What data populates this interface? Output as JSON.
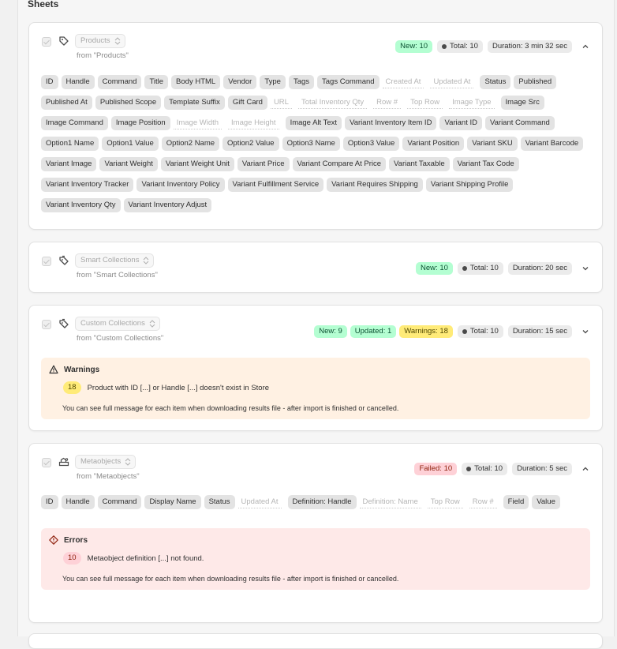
{
  "header": {
    "title": "Sheets"
  },
  "sheets": [
    {
      "name": "Products",
      "from": "from \"Products\"",
      "badges": {
        "new": "New: 10",
        "total": "Total: 10",
        "duration": "Duration: 3 min 32 sec"
      },
      "expanded": true,
      "fields": [
        {
          "label": "ID",
          "active": true
        },
        {
          "label": "Handle",
          "active": true
        },
        {
          "label": "Command",
          "active": true
        },
        {
          "label": "Title",
          "active": true
        },
        {
          "label": "Body HTML",
          "active": true
        },
        {
          "label": "Vendor",
          "active": true
        },
        {
          "label": "Type",
          "active": true
        },
        {
          "label": "Tags",
          "active": true
        },
        {
          "label": "Tags Command",
          "active": true
        },
        {
          "label": "Created At",
          "active": false
        },
        {
          "label": "Updated At",
          "active": false
        },
        {
          "label": "Status",
          "active": true
        },
        {
          "label": "Published",
          "active": true
        },
        {
          "label": "Published At",
          "active": true
        },
        {
          "label": "Published Scope",
          "active": true
        },
        {
          "label": "Template Suffix",
          "active": true
        },
        {
          "label": "Gift Card",
          "active": true
        },
        {
          "label": "URL",
          "active": false
        },
        {
          "label": "Total Inventory Qty",
          "active": false
        },
        {
          "label": "Row #",
          "active": false
        },
        {
          "label": "Top Row",
          "active": false
        },
        {
          "label": "Image Type",
          "active": false
        },
        {
          "label": "Image Src",
          "active": true
        },
        {
          "label": "Image Command",
          "active": true
        },
        {
          "label": "Image Position",
          "active": true
        },
        {
          "label": "Image Width",
          "active": false
        },
        {
          "label": "Image Height",
          "active": false
        },
        {
          "label": "Image Alt Text",
          "active": true
        },
        {
          "label": "Variant Inventory Item ID",
          "active": true
        },
        {
          "label": "Variant ID",
          "active": true
        },
        {
          "label": "Variant Command",
          "active": true
        },
        {
          "label": "Option1 Name",
          "active": true
        },
        {
          "label": "Option1 Value",
          "active": true
        },
        {
          "label": "Option2 Name",
          "active": true
        },
        {
          "label": "Option2 Value",
          "active": true
        },
        {
          "label": "Option3 Name",
          "active": true
        },
        {
          "label": "Option3 Value",
          "active": true
        },
        {
          "label": "Variant Position",
          "active": true
        },
        {
          "label": "Variant SKU",
          "active": true
        },
        {
          "label": "Variant Barcode",
          "active": true
        },
        {
          "label": "Variant Image",
          "active": true
        },
        {
          "label": "Variant Weight",
          "active": true
        },
        {
          "label": "Variant Weight Unit",
          "active": true
        },
        {
          "label": "Variant Price",
          "active": true
        },
        {
          "label": "Variant Compare At Price",
          "active": true
        },
        {
          "label": "Variant Taxable",
          "active": true
        },
        {
          "label": "Variant Tax Code",
          "active": true
        },
        {
          "label": "Variant Inventory Tracker",
          "active": true
        },
        {
          "label": "Variant Inventory Policy",
          "active": true
        },
        {
          "label": "Variant Fulfillment Service",
          "active": true
        },
        {
          "label": "Variant Requires Shipping",
          "active": true
        },
        {
          "label": "Variant Shipping Profile",
          "active": true
        },
        {
          "label": "Variant Inventory Qty",
          "active": true
        },
        {
          "label": "Variant Inventory Adjust",
          "active": true
        }
      ]
    },
    {
      "name": "Smart Collections",
      "from": "from \"Smart Collections\"",
      "badges": {
        "new": "New: 10",
        "total": "Total: 10",
        "duration": "Duration: 20 sec"
      },
      "expanded": false
    },
    {
      "name": "Custom Collections",
      "from": "from \"Custom Collections\"",
      "badges": {
        "new": "New: 9",
        "updated": "Updated: 1",
        "warnings": "Warnings: 18",
        "total": "Total: 10",
        "duration": "Duration: 15 sec"
      },
      "expanded": false,
      "banner": {
        "title": "Warnings",
        "count": "18",
        "message": "Product with ID [...] or Handle [...] doesn't exist in Store",
        "note": "You can see full message for each item when downloading results file - after import is finished or cancelled."
      }
    },
    {
      "name": "Metaobjects",
      "from": "from \"Metaobjects\"",
      "badges": {
        "failed": "Failed: 10",
        "total": "Total: 10",
        "duration": "Duration: 5 sec"
      },
      "expanded": true,
      "fields": [
        {
          "label": "ID",
          "active": true
        },
        {
          "label": "Handle",
          "active": true
        },
        {
          "label": "Command",
          "active": true
        },
        {
          "label": "Display Name",
          "active": true
        },
        {
          "label": "Status",
          "active": true
        },
        {
          "label": "Updated At",
          "active": false
        },
        {
          "label": "Definition: Handle",
          "active": true
        },
        {
          "label": "Definition: Name",
          "active": false
        },
        {
          "label": "Top Row",
          "active": false
        },
        {
          "label": "Row #",
          "active": false
        },
        {
          "label": "Field",
          "active": true
        },
        {
          "label": "Value",
          "active": true
        }
      ],
      "banner": {
        "title": "Errors",
        "count": "10",
        "message": "Metaobject definition [...] not found.",
        "note": "You can see full message for each item when downloading results file - after import is finished or cancelled."
      }
    }
  ],
  "colors": {
    "new": "#b4fed2",
    "warning": "#ffeb78",
    "failed": "#fed1d7",
    "warning_bg": "#fff1e3",
    "error_bg": "#fee9e8"
  }
}
